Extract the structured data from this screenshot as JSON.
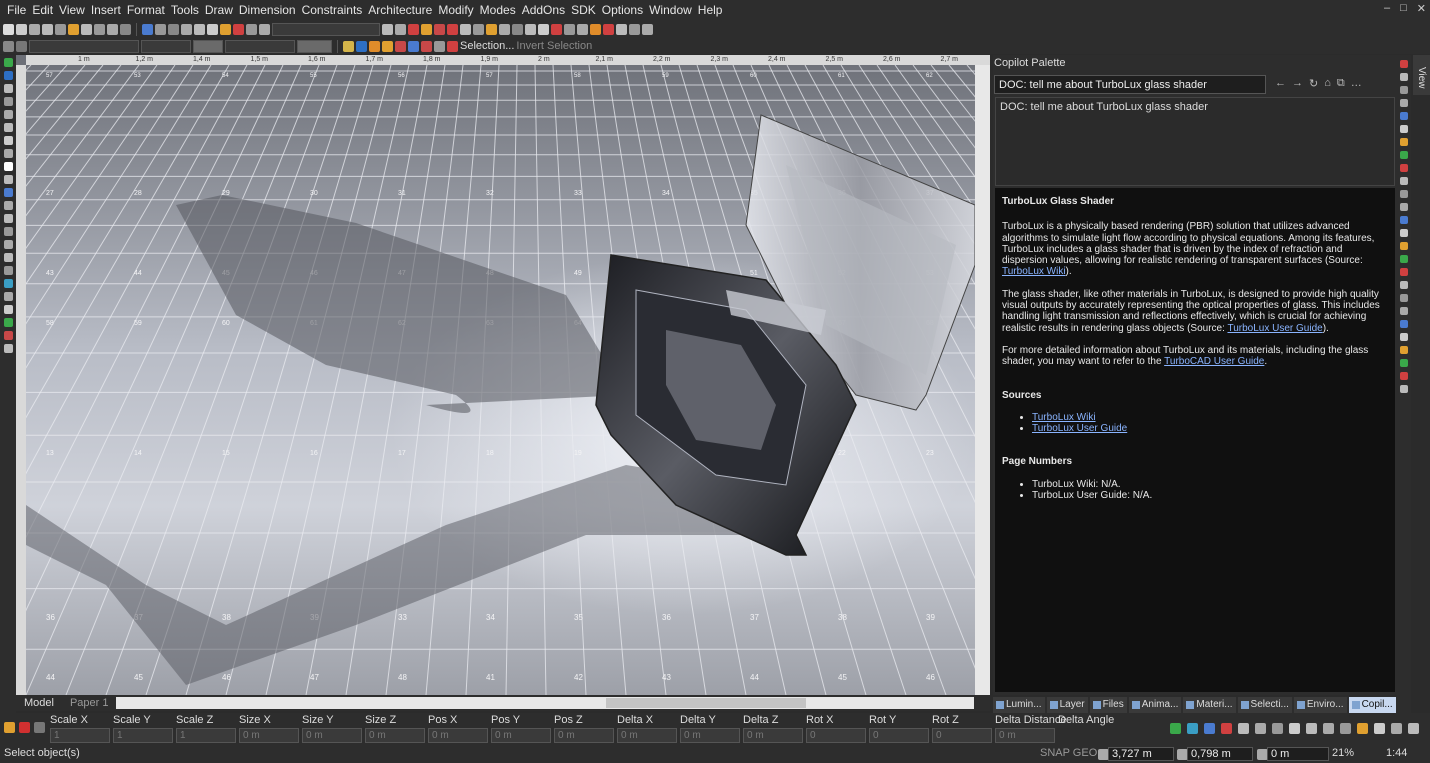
{
  "menu": [
    "File",
    "Edit",
    "View",
    "Insert",
    "Format",
    "Tools",
    "Draw",
    "Dimension",
    "Constraints",
    "Architecture",
    "Modify",
    "Modes",
    "AddOns",
    "SDK",
    "Options",
    "Window",
    "Help"
  ],
  "window_controls": {
    "minimize": "–",
    "restore": "□",
    "close": "✕"
  },
  "toolbar2": {
    "selection_label": "Selection...",
    "invert_label": "Invert Selection"
  },
  "ruler": {
    "top_ticks": [
      "1 m",
      "1,2 m",
      "1,4 m",
      "1,5 m",
      "1,6 m",
      "1,7 m",
      "1,8 m",
      "1,9 m",
      "2 m",
      "2,1 m",
      "2,2 m",
      "2,3 m",
      "2,4 m",
      "2,5 m",
      "2,6 m",
      "2,7 m"
    ]
  },
  "viewport": {
    "grid_numbers_row": [
      [
        "57",
        "53",
        "54",
        "55",
        "56",
        "57",
        "58",
        "59",
        "60",
        "61",
        "62"
      ],
      [
        "27",
        "28",
        "29",
        "30",
        "31",
        "32",
        "33",
        "34",
        "35",
        "36",
        "37"
      ],
      [
        "43",
        "44",
        "45",
        "46",
        "47",
        "48",
        "49",
        "50",
        "51",
        "52",
        "53"
      ],
      [
        "58",
        "59",
        "60",
        "61",
        "62",
        "63",
        "64",
        "65",
        "66",
        "67",
        "68"
      ],
      [
        "13",
        "14",
        "15",
        "16",
        "17",
        "18",
        "19",
        "20",
        "21",
        "22",
        "23"
      ],
      [
        "36",
        "37",
        "38",
        "39",
        "33",
        "34",
        "35",
        "36",
        "37",
        "38",
        "39"
      ],
      [
        "44",
        "45",
        "46",
        "47",
        "48",
        "41",
        "42",
        "43",
        "44",
        "45",
        "46"
      ]
    ]
  },
  "layout_tabs": {
    "model": "Model",
    "paper": "Paper 1"
  },
  "copilot": {
    "title": "Copilot Palette",
    "search_value": "DOC: tell me about TurboLux glass shader",
    "query_echo": "DOC: tell me about TurboLux glass shader",
    "nav_icons": [
      "←",
      "→",
      "↻",
      "⌂",
      "⧉",
      "…"
    ],
    "answer": {
      "heading": "TurboLux Glass Shader",
      "p1": "TurboLux is a physically based rendering (PBR) solution that utilizes advanced algorithms to simulate light flow according to physical equations. Among its features, TurboLux includes a glass shader that is driven by the index of refraction and dispersion values, allowing for realistic rendering of transparent surfaces (Source: ",
      "p1_link": "TurboLux Wiki",
      "p1_end": ").",
      "p2": "The glass shader, like other materials in TurboLux, is designed to provide high quality visual outputs by accurately representing the optical properties of glass. This includes handling light transmission and reflections effectively, which is crucial for achieving realistic results in rendering glass objects (Source: ",
      "p2_link": "TurboLux User Guide",
      "p2_end": ").",
      "p3": "For more detailed information about TurboLux and its materials, including the glass shader, you may want to refer to the ",
      "p3_link": "TurboCAD User Guide",
      "p3_end": ".",
      "sources_heading": "Sources",
      "sources": [
        "TurboLux Wiki",
        "TurboLux User Guide"
      ],
      "pages_heading": "Page Numbers",
      "pages": [
        "TurboLux Wiki: N/A.",
        "TurboLux User Guide: N/A."
      ]
    }
  },
  "view_tab": "View",
  "palette_tabs": [
    "Lumin...",
    "Layer",
    "Files",
    "Anima...",
    "Materi...",
    "Selecti...",
    "Enviro...",
    "Copil..."
  ],
  "inspector": {
    "labels": [
      "Scale X",
      "Scale Y",
      "Scale Z",
      "Size X",
      "Size Y",
      "Size Z",
      "Pos X",
      "Pos Y",
      "Pos Z",
      "Delta X",
      "Delta Y",
      "Delta Z",
      "Rot X",
      "Rot Y",
      "Rot Z",
      "Delta Distance",
      "Delta Angle"
    ],
    "values": [
      "1",
      "1",
      "1",
      "0 m",
      "0 m",
      "0 m",
      "0 m",
      "0 m",
      "0 m",
      "0 m",
      "0 m",
      "0 m",
      "0",
      "0",
      "0",
      "0 m",
      "0"
    ]
  },
  "status": {
    "message": "Select object(s)",
    "snap": "SNAP GEO",
    "x": "3,727 m",
    "y": "0,798 m",
    "z": "0 m",
    "zoom": "21%",
    "time": "1:44"
  },
  "colors": {
    "accent": "#2d6fc4",
    "panel": "#2d2d2d",
    "answer_bg": "#101010",
    "link": "#8ab4ff"
  }
}
